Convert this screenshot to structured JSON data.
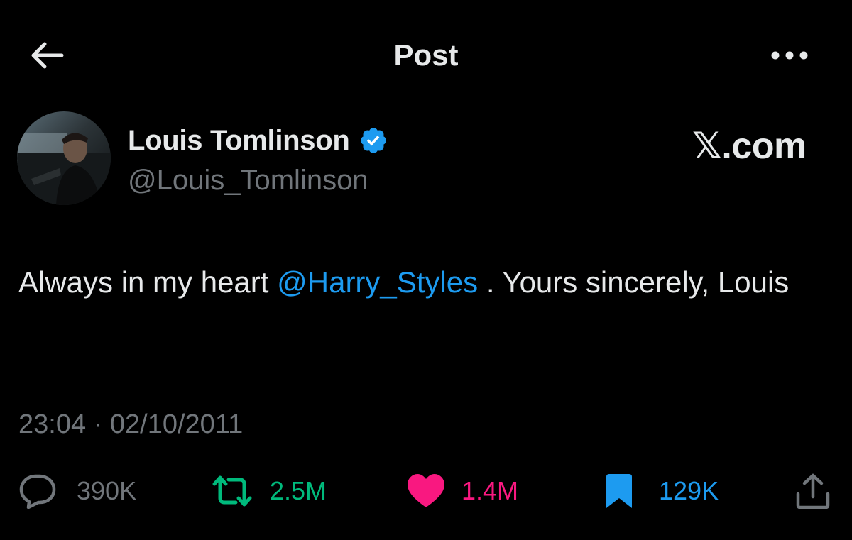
{
  "header": {
    "title": "Post",
    "back_icon": "arrow-left-icon",
    "more_icon": "more-horizontal-icon"
  },
  "author": {
    "name": "Louis Tomlinson",
    "handle": "@Louis_Tomlinson",
    "verified_icon": "verified-badge-icon",
    "verified_color": "#1d9bf0"
  },
  "watermark": {
    "x": "𝕏",
    "domain": ".com"
  },
  "tweet": {
    "text_before": "Always in my heart ",
    "mention": "@Harry_Styles",
    "text_after": " . Yours sincerely, Louis",
    "mention_color": "#1d9bf0"
  },
  "timestamp": {
    "time": "23:04",
    "separator": " · ",
    "date": "02/10/2011"
  },
  "actions": {
    "replies": {
      "icon": "reply-icon",
      "count": "390K",
      "color": "#71767b"
    },
    "reposts": {
      "icon": "repost-icon",
      "count": "2.5M",
      "color": "#00ba7c"
    },
    "likes": {
      "icon": "heart-icon",
      "count": "1.4M",
      "color": "#f91880"
    },
    "bookmarks": {
      "icon": "bookmark-icon",
      "count": "129K",
      "color": "#1d9bf0"
    },
    "share": {
      "icon": "share-icon"
    }
  },
  "colors": {
    "background": "#000000",
    "text_primary": "#e7e9ea",
    "text_secondary": "#71767b"
  }
}
